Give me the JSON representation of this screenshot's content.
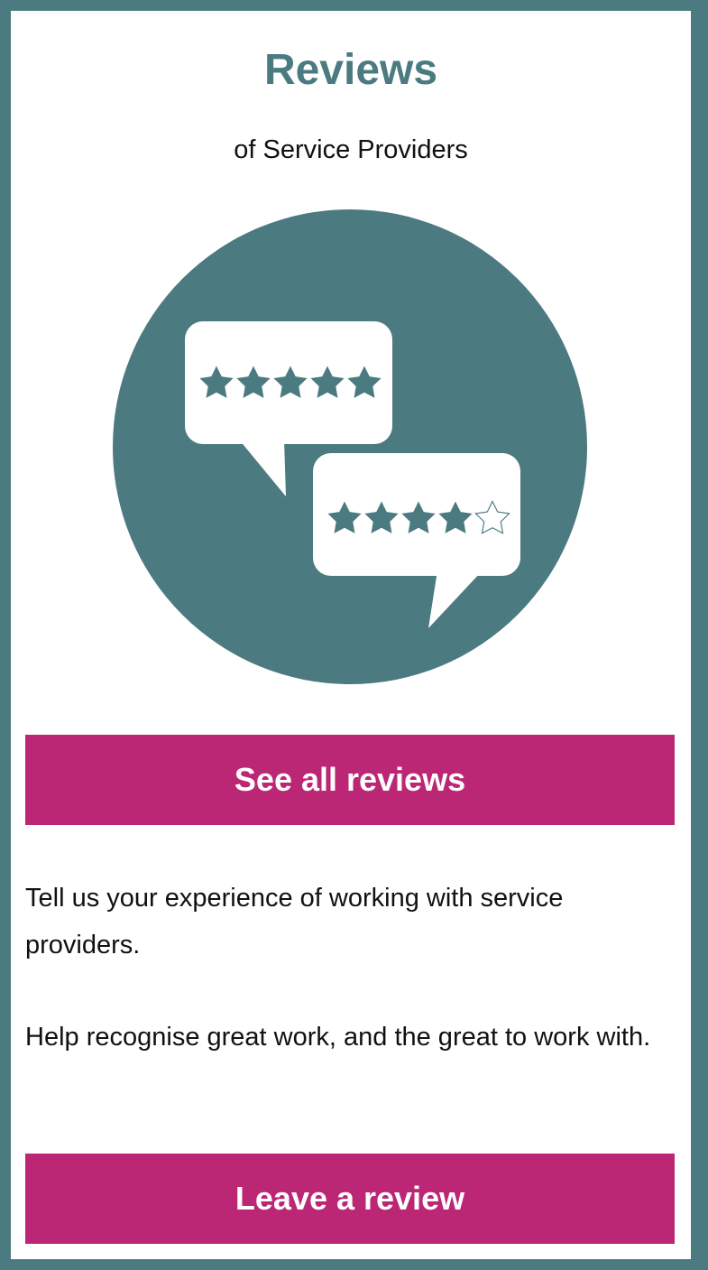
{
  "colors": {
    "frame": "#4b7a80",
    "accent": "#bb2675",
    "card": "#ffffff",
    "text": "#111111"
  },
  "header": {
    "title": "Reviews",
    "subtitle": "of Service Providers"
  },
  "illustration": {
    "icon": "speech-bubbles-star-rating-icon",
    "ratings": [
      {
        "stars_filled": 5,
        "stars_total": 5
      },
      {
        "stars_filled": 4,
        "stars_total": 5
      }
    ]
  },
  "actions": {
    "see_all_label": "See all reviews",
    "leave_review_label": "Leave a review"
  },
  "body": {
    "paragraph_1": "Tell us your experience of working with service providers.",
    "paragraph_2": "Help recognise great work, and the great to work with."
  }
}
